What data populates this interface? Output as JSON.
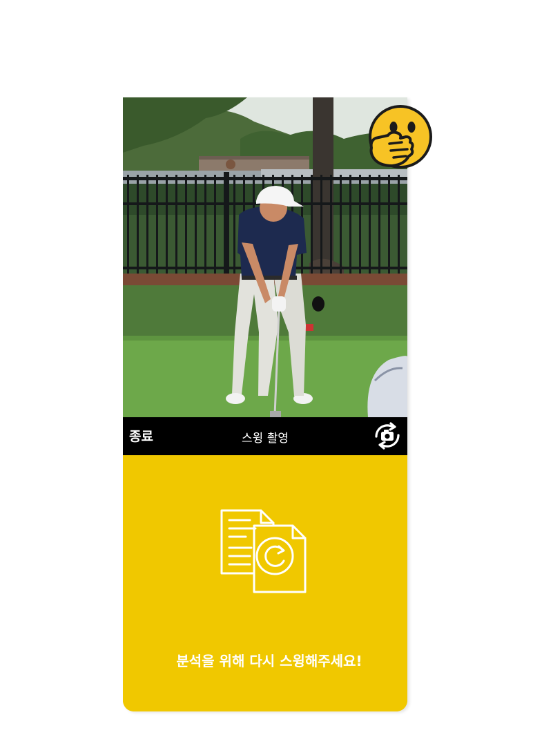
{
  "header": {
    "exit_label": "종료",
    "title": "스윙 촬영",
    "camera_flip_icon": "camera-flip-icon"
  },
  "panel": {
    "icon": "document-refresh-icon",
    "message": "분석을 위해 다시 스윙해주세요!"
  },
  "overlay_emoji": "face-with-hand-over-mouth-icon",
  "colors": {
    "accent_yellow": "#f0c800",
    "bar_black": "#000000",
    "text_white": "#ffffff",
    "emoji_yellow": "#f7c325"
  }
}
